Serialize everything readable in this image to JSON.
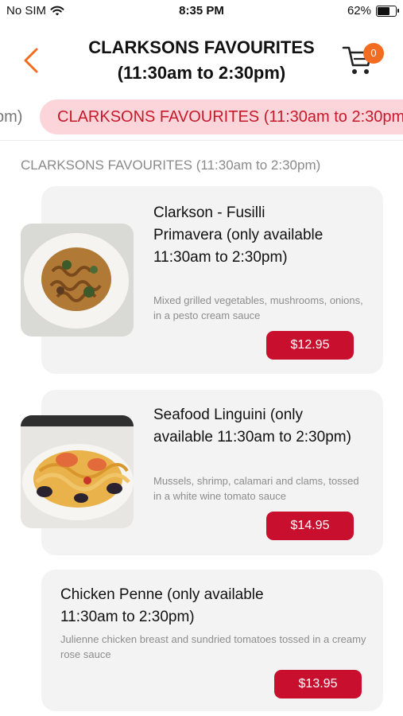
{
  "status_bar": {
    "carrier": "No SIM",
    "time": "8:35 PM",
    "battery": "62%",
    "battery_level": 0.62
  },
  "header": {
    "title_line1": "CLARKSONS FAVOURITES",
    "title_line2": "(11:30am to 2:30pm)",
    "cart_count": "0"
  },
  "categories": {
    "prev_chip": "pm)",
    "active_chip": "CLARKSONS FAVOURITES  (11:30am to 2:30pm)"
  },
  "section": {
    "title": "CLARKSONS FAVOURITES  (11:30am to 2:30pm)"
  },
  "items": [
    {
      "name": "Clarkson - Fusilli Primavera (only available 11:30am to 2:30pm)",
      "description": "Mixed grilled vegetables, mushrooms, onions, in a pesto cream sauce",
      "price": "$12.95"
    },
    {
      "name": "Seafood Linguini (only available 11:30am to 2:30pm)",
      "description": "Mussels, shrimp, calamari and clams, tossed in a white wine tomato sauce",
      "price": "$14.95"
    },
    {
      "name": "Chicken Penne (only available 11:30am to 2:30pm)",
      "description": "Julienne chicken breast and sundried tomatoes tossed in a creamy rose sauce",
      "price": "$13.95"
    }
  ],
  "colors": {
    "accent_orange": "#f26d21",
    "price_red": "#c8102e",
    "chip_bg": "#fbd5da",
    "chip_text": "#c8192b",
    "card_bg": "#f3f3f3"
  }
}
